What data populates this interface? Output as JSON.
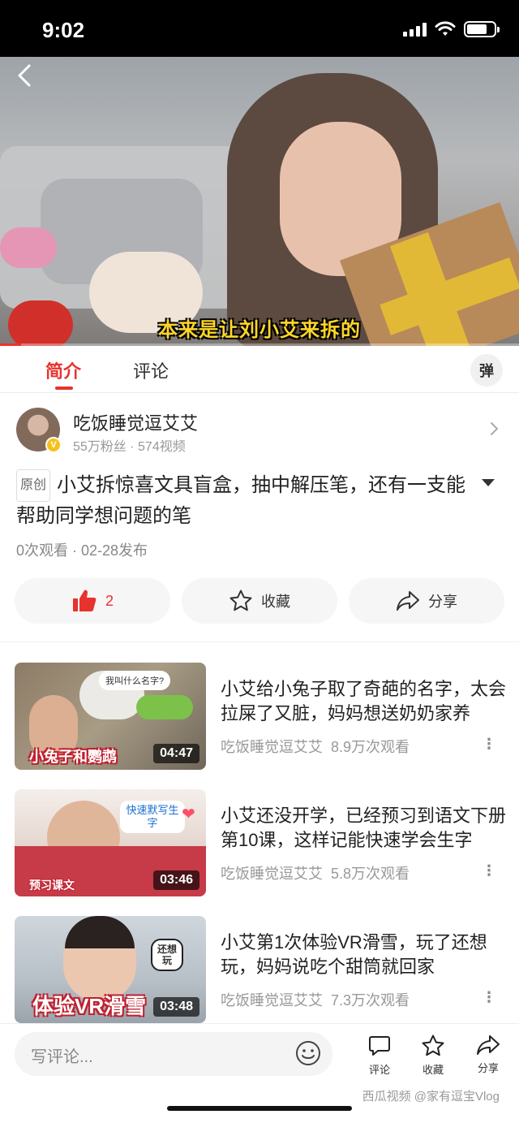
{
  "status_bar": {
    "time": "9:02"
  },
  "video": {
    "subtitle": "本来是让刘小艾来拆的",
    "progress": 0.04
  },
  "tabs": {
    "intro": "简介",
    "comment": "评论",
    "danmaku": "弹"
  },
  "author": {
    "name": "吃饭睡觉逗艾艾",
    "stats": "55万粉丝 · 574视频"
  },
  "video_info": {
    "original_badge": "原创",
    "title": "小艾拆惊喜文具盲盒，抽中解压笔，还有一支能帮助同学想问题的笔",
    "meta": "0次观看 · 02-28发布"
  },
  "actions": {
    "like_count": "2",
    "favorite_label": "收藏",
    "share_label": "分享"
  },
  "related": [
    {
      "title": "小艾给小兔子取了奇葩的名字，太会拉屎了又脏，妈妈想送奶奶家养",
      "author": "吃饭睡觉逗艾艾",
      "views": "8.9万次观看",
      "duration": "04:47",
      "caption": "小兔子和鹦鹉",
      "bubble": "我叫什么名字?"
    },
    {
      "title": "小艾还没开学，已经预习到语文下册第10课，这样记能快速学会生字",
      "author": "吃饭睡觉逗艾艾",
      "views": "5.8万次观看",
      "duration": "03:46",
      "caption": "预习课文",
      "bubble": "快速默写生字"
    },
    {
      "title": "小艾第1次体验VR滑雪，玩了还想玩，妈妈说吃个甜筒就回家",
      "author": "吃饭睡觉逗艾艾",
      "views": "7.3万次观看",
      "duration": "03:48",
      "caption": "体验VR滑雪",
      "bubble": "还想玩"
    }
  ],
  "comment_bar": {
    "placeholder": "写评论...",
    "comment_label": "评论",
    "favorite_label": "收藏",
    "share_label": "分享",
    "watermark": "西瓜视频 @家有逗宝Vlog"
  }
}
